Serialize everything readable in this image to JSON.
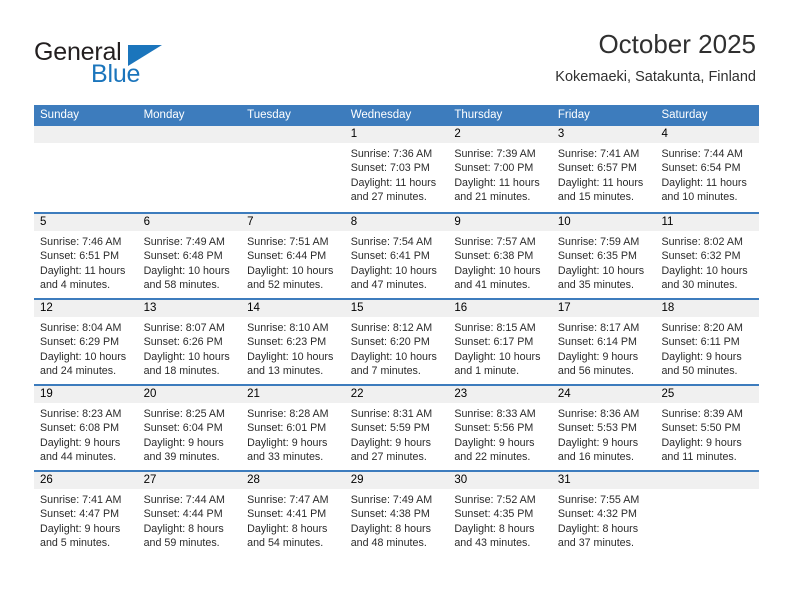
{
  "logo": {
    "line1": "General",
    "line2": "Blue",
    "triangle_color": "#1b75bc"
  },
  "header": {
    "title": "October 2025",
    "subtitle": "Kokemaeki, Satakunta, Finland",
    "header_bg": "#3d7cbd",
    "daynum_bg": "#f0f0f0"
  },
  "weekdays": [
    "Sunday",
    "Monday",
    "Tuesday",
    "Wednesday",
    "Thursday",
    "Friday",
    "Saturday"
  ],
  "weeks": [
    [
      {
        "day": "",
        "empty": true
      },
      {
        "day": "",
        "empty": true
      },
      {
        "day": "",
        "empty": true
      },
      {
        "day": "1",
        "sunrise": "Sunrise: 7:36 AM",
        "sunset": "Sunset: 7:03 PM",
        "daylight1": "Daylight: 11 hours",
        "daylight2": "and 27 minutes."
      },
      {
        "day": "2",
        "sunrise": "Sunrise: 7:39 AM",
        "sunset": "Sunset: 7:00 PM",
        "daylight1": "Daylight: 11 hours",
        "daylight2": "and 21 minutes."
      },
      {
        "day": "3",
        "sunrise": "Sunrise: 7:41 AM",
        "sunset": "Sunset: 6:57 PM",
        "daylight1": "Daylight: 11 hours",
        "daylight2": "and 15 minutes."
      },
      {
        "day": "4",
        "sunrise": "Sunrise: 7:44 AM",
        "sunset": "Sunset: 6:54 PM",
        "daylight1": "Daylight: 11 hours",
        "daylight2": "and 10 minutes."
      }
    ],
    [
      {
        "day": "5",
        "sunrise": "Sunrise: 7:46 AM",
        "sunset": "Sunset: 6:51 PM",
        "daylight1": "Daylight: 11 hours",
        "daylight2": "and 4 minutes."
      },
      {
        "day": "6",
        "sunrise": "Sunrise: 7:49 AM",
        "sunset": "Sunset: 6:48 PM",
        "daylight1": "Daylight: 10 hours",
        "daylight2": "and 58 minutes."
      },
      {
        "day": "7",
        "sunrise": "Sunrise: 7:51 AM",
        "sunset": "Sunset: 6:44 PM",
        "daylight1": "Daylight: 10 hours",
        "daylight2": "and 52 minutes."
      },
      {
        "day": "8",
        "sunrise": "Sunrise: 7:54 AM",
        "sunset": "Sunset: 6:41 PM",
        "daylight1": "Daylight: 10 hours",
        "daylight2": "and 47 minutes."
      },
      {
        "day": "9",
        "sunrise": "Sunrise: 7:57 AM",
        "sunset": "Sunset: 6:38 PM",
        "daylight1": "Daylight: 10 hours",
        "daylight2": "and 41 minutes."
      },
      {
        "day": "10",
        "sunrise": "Sunrise: 7:59 AM",
        "sunset": "Sunset: 6:35 PM",
        "daylight1": "Daylight: 10 hours",
        "daylight2": "and 35 minutes."
      },
      {
        "day": "11",
        "sunrise": "Sunrise: 8:02 AM",
        "sunset": "Sunset: 6:32 PM",
        "daylight1": "Daylight: 10 hours",
        "daylight2": "and 30 minutes."
      }
    ],
    [
      {
        "day": "12",
        "sunrise": "Sunrise: 8:04 AM",
        "sunset": "Sunset: 6:29 PM",
        "daylight1": "Daylight: 10 hours",
        "daylight2": "and 24 minutes."
      },
      {
        "day": "13",
        "sunrise": "Sunrise: 8:07 AM",
        "sunset": "Sunset: 6:26 PM",
        "daylight1": "Daylight: 10 hours",
        "daylight2": "and 18 minutes."
      },
      {
        "day": "14",
        "sunrise": "Sunrise: 8:10 AM",
        "sunset": "Sunset: 6:23 PM",
        "daylight1": "Daylight: 10 hours",
        "daylight2": "and 13 minutes."
      },
      {
        "day": "15",
        "sunrise": "Sunrise: 8:12 AM",
        "sunset": "Sunset: 6:20 PM",
        "daylight1": "Daylight: 10 hours",
        "daylight2": "and 7 minutes."
      },
      {
        "day": "16",
        "sunrise": "Sunrise: 8:15 AM",
        "sunset": "Sunset: 6:17 PM",
        "daylight1": "Daylight: 10 hours",
        "daylight2": "and 1 minute."
      },
      {
        "day": "17",
        "sunrise": "Sunrise: 8:17 AM",
        "sunset": "Sunset: 6:14 PM",
        "daylight1": "Daylight: 9 hours",
        "daylight2": "and 56 minutes."
      },
      {
        "day": "18",
        "sunrise": "Sunrise: 8:20 AM",
        "sunset": "Sunset: 6:11 PM",
        "daylight1": "Daylight: 9 hours",
        "daylight2": "and 50 minutes."
      }
    ],
    [
      {
        "day": "19",
        "sunrise": "Sunrise: 8:23 AM",
        "sunset": "Sunset: 6:08 PM",
        "daylight1": "Daylight: 9 hours",
        "daylight2": "and 44 minutes."
      },
      {
        "day": "20",
        "sunrise": "Sunrise: 8:25 AM",
        "sunset": "Sunset: 6:04 PM",
        "daylight1": "Daylight: 9 hours",
        "daylight2": "and 39 minutes."
      },
      {
        "day": "21",
        "sunrise": "Sunrise: 8:28 AM",
        "sunset": "Sunset: 6:01 PM",
        "daylight1": "Daylight: 9 hours",
        "daylight2": "and 33 minutes."
      },
      {
        "day": "22",
        "sunrise": "Sunrise: 8:31 AM",
        "sunset": "Sunset: 5:59 PM",
        "daylight1": "Daylight: 9 hours",
        "daylight2": "and 27 minutes."
      },
      {
        "day": "23",
        "sunrise": "Sunrise: 8:33 AM",
        "sunset": "Sunset: 5:56 PM",
        "daylight1": "Daylight: 9 hours",
        "daylight2": "and 22 minutes."
      },
      {
        "day": "24",
        "sunrise": "Sunrise: 8:36 AM",
        "sunset": "Sunset: 5:53 PM",
        "daylight1": "Daylight: 9 hours",
        "daylight2": "and 16 minutes."
      },
      {
        "day": "25",
        "sunrise": "Sunrise: 8:39 AM",
        "sunset": "Sunset: 5:50 PM",
        "daylight1": "Daylight: 9 hours",
        "daylight2": "and 11 minutes."
      }
    ],
    [
      {
        "day": "26",
        "sunrise": "Sunrise: 7:41 AM",
        "sunset": "Sunset: 4:47 PM",
        "daylight1": "Daylight: 9 hours",
        "daylight2": "and 5 minutes."
      },
      {
        "day": "27",
        "sunrise": "Sunrise: 7:44 AM",
        "sunset": "Sunset: 4:44 PM",
        "daylight1": "Daylight: 8 hours",
        "daylight2": "and 59 minutes."
      },
      {
        "day": "28",
        "sunrise": "Sunrise: 7:47 AM",
        "sunset": "Sunset: 4:41 PM",
        "daylight1": "Daylight: 8 hours",
        "daylight2": "and 54 minutes."
      },
      {
        "day": "29",
        "sunrise": "Sunrise: 7:49 AM",
        "sunset": "Sunset: 4:38 PM",
        "daylight1": "Daylight: 8 hours",
        "daylight2": "and 48 minutes."
      },
      {
        "day": "30",
        "sunrise": "Sunrise: 7:52 AM",
        "sunset": "Sunset: 4:35 PM",
        "daylight1": "Daylight: 8 hours",
        "daylight2": "and 43 minutes."
      },
      {
        "day": "31",
        "sunrise": "Sunrise: 7:55 AM",
        "sunset": "Sunset: 4:32 PM",
        "daylight1": "Daylight: 8 hours",
        "daylight2": "and 37 minutes."
      },
      {
        "day": "",
        "empty": true
      }
    ]
  ]
}
